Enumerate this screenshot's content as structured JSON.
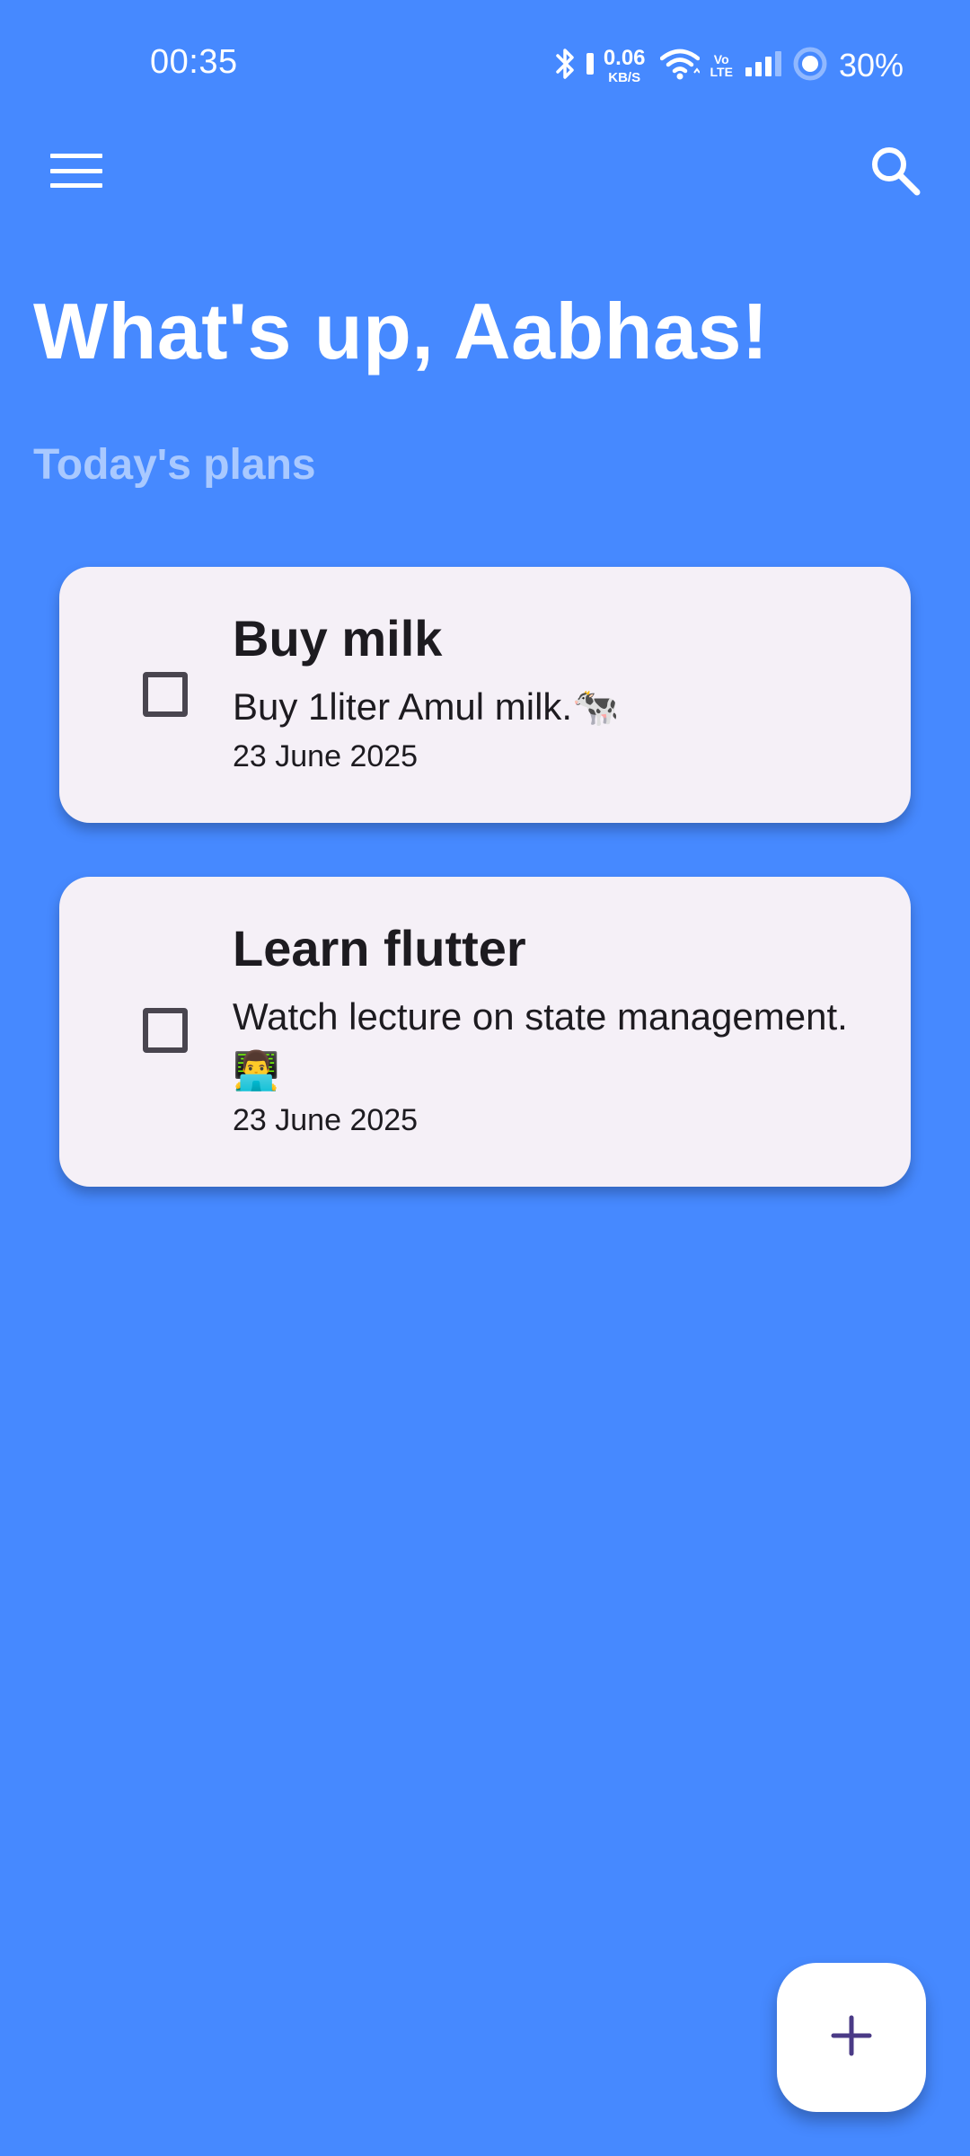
{
  "colors": {
    "background": "#4689ff",
    "card": "#f5f0f7",
    "subtitle": "#a9c9ff",
    "fab_icon": "#4a3a86"
  },
  "status_bar": {
    "time": "00:35",
    "net_speed_value": "0.06",
    "net_speed_unit": "KB/S",
    "volte_top": "Vo",
    "volte_bottom": "LTE",
    "battery": "30%",
    "icons": [
      "bluetooth-icon",
      "wifi-icon",
      "signal-icon",
      "battery-ring-icon"
    ]
  },
  "app_bar": {
    "menu_icon": "hamburger-menu-icon",
    "search_icon": "search-icon"
  },
  "greeting": "What's up, Aabhas!",
  "section_title": "Today's plans",
  "todos": [
    {
      "title": "Buy milk",
      "description": "Buy 1liter Amul milk.🐄",
      "date": "23 June 2025",
      "checked": false
    },
    {
      "title": "Learn flutter",
      "description": "Watch lecture on state management.👨‍💻",
      "date": "23 June 2025",
      "checked": false
    }
  ],
  "fab": {
    "icon": "plus-icon"
  }
}
